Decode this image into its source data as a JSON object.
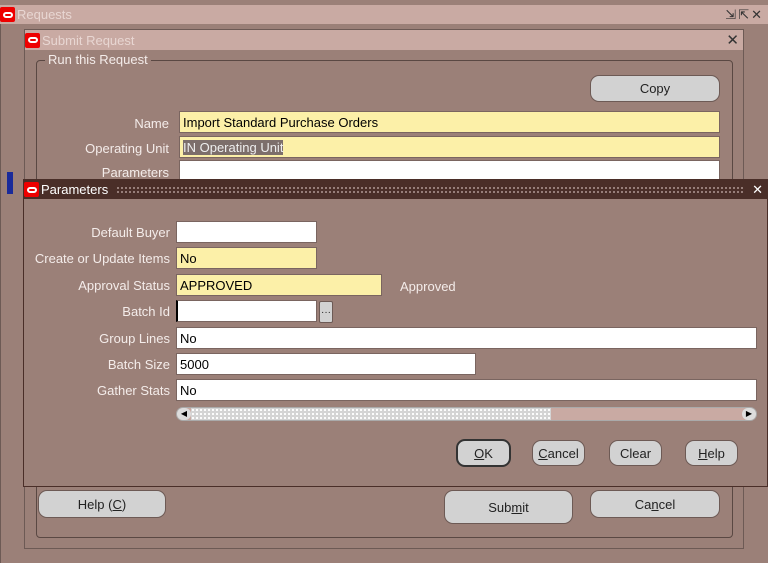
{
  "requests_window": {
    "title": "Requests",
    "controls": [
      "minimize-icon",
      "maximize-icon",
      "close-icon"
    ]
  },
  "submit_window": {
    "title": "Submit Request",
    "group_label": "Run this Request",
    "copy_label": "Copy",
    "name_label": "Name",
    "name_value": "Import Standard Purchase Orders",
    "ou_label": "Operating Unit",
    "ou_value": "IN Operating Unit",
    "params_label": "Parameters",
    "params_value": "",
    "help": {
      "pre": "Help (",
      "key": "C",
      "post": ")"
    },
    "submit": {
      "pre": "Sub",
      "key": "m",
      "post": "it"
    },
    "cancel": {
      "pre": "Ca",
      "key": "n",
      "post": "cel"
    }
  },
  "parameters_window": {
    "title": "Parameters",
    "fields": [
      {
        "label": "Default Buyer",
        "value": "",
        "required": false
      },
      {
        "label": "Create or Update Items",
        "value": "No",
        "required": true
      },
      {
        "label": "Approval Status",
        "value": "APPROVED",
        "required": true,
        "description": "Approved"
      },
      {
        "label": "Batch Id",
        "value": "",
        "required": false
      },
      {
        "label": "Group Lines",
        "value": "No",
        "required": false
      },
      {
        "label": "Batch Size",
        "value": "5000",
        "required": false
      },
      {
        "label": "Gather Stats",
        "value": "No",
        "required": false
      }
    ],
    "scroll_position": 0.0,
    "ok": {
      "key": "O",
      "post": "K"
    },
    "cancel": {
      "key": "C",
      "post": "ancel"
    },
    "clear": {
      "label": "Clear"
    },
    "help": {
      "key": "H",
      "post": "elp"
    }
  },
  "colors": {
    "background": "#9b8078",
    "required_field": "#fcf0a8",
    "active_titlebar": "#4a2e28",
    "inactive_titlebar": "#c9aaa3"
  }
}
